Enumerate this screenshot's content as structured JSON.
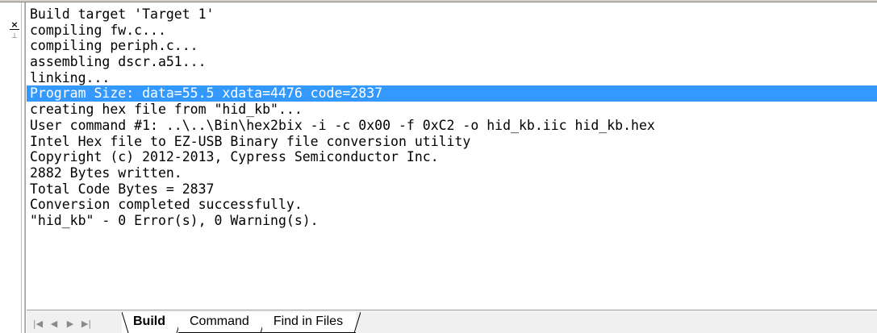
{
  "output": {
    "lines": [
      "Build target 'Target 1'",
      "compiling fw.c...",
      "compiling periph.c...",
      "assembling dscr.a51...",
      "linking...",
      "Program Size: data=55.5 xdata=4476 code=2837",
      "creating hex file from \"hid_kb\"...",
      "User command #1: ..\\..\\Bin\\hex2bix -i -c 0x00 -f 0xC2 -o hid_kb.iic hid_kb.hex",
      "Intel Hex file to EZ-USB Binary file conversion utility",
      "Copyright (c) 2012-2013, Cypress Semiconductor Inc.",
      "2882 Bytes written.",
      "Total Code Bytes = 2837",
      "Conversion completed successfully.",
      "\"hid_kb\" - 0 Error(s), 0 Warning(s)."
    ],
    "selected_line": 5
  },
  "controls": {
    "close_glyph": "×",
    "pin_glyph": "⊥"
  },
  "nav": {
    "first_glyph": "|◀",
    "prev_glyph": "◀",
    "next_glyph": "▶",
    "last_glyph": "▶|"
  },
  "tabs": [
    {
      "label": "Build",
      "active": true
    },
    {
      "label": "Command",
      "active": false
    },
    {
      "label": "Find in Files",
      "active": false
    }
  ],
  "icons": {
    "close": "close-icon",
    "pin": "pin-icon",
    "first": "first-page-icon",
    "prev": "previous-page-icon",
    "next": "next-page-icon",
    "last": "last-page-icon"
  },
  "colors": {
    "selection_bg": "#3399ff",
    "selection_fg": "#ffffff"
  }
}
